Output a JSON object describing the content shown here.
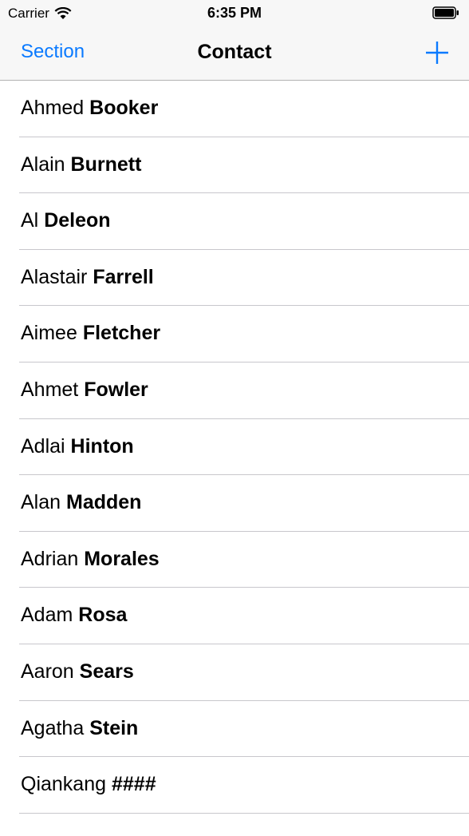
{
  "status_bar": {
    "carrier": "Carrier",
    "time": "6:35 PM"
  },
  "nav": {
    "left_label": "Section",
    "title": "Contact",
    "accent_color": "#0a7aff"
  },
  "contacts": [
    {
      "first": "Ahmed",
      "last": "Booker"
    },
    {
      "first": "Alain",
      "last": "Burnett"
    },
    {
      "first": "Al",
      "last": "Deleon"
    },
    {
      "first": "Alastair",
      "last": "Farrell"
    },
    {
      "first": "Aimee",
      "last": "Fletcher"
    },
    {
      "first": "Ahmet",
      "last": "Fowler"
    },
    {
      "first": "Adlai",
      "last": "Hinton"
    },
    {
      "first": "Alan",
      "last": "Madden"
    },
    {
      "first": "Adrian",
      "last": "Morales"
    },
    {
      "first": "Adam",
      "last": "Rosa"
    },
    {
      "first": "Aaron",
      "last": "Sears"
    },
    {
      "first": "Agatha",
      "last": "Stein"
    },
    {
      "first": "Qiankang",
      "last": "####"
    }
  ]
}
